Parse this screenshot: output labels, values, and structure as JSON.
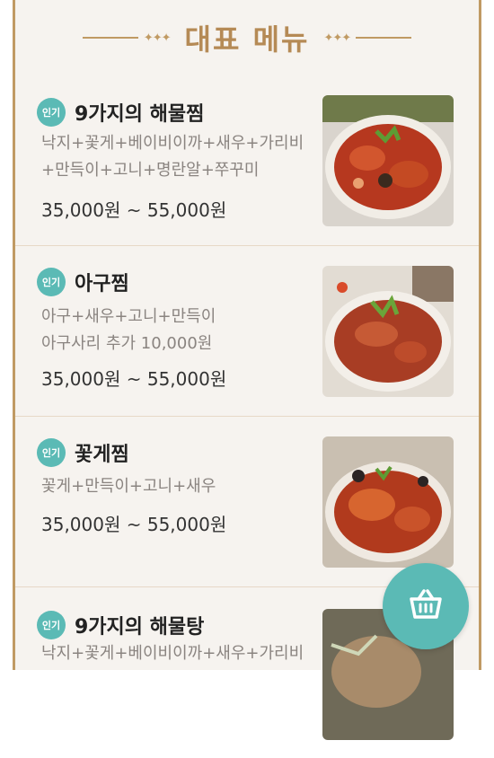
{
  "header": {
    "title": "대표 메뉴",
    "deco_left": "✦✦✦",
    "deco_right": "✦✦✦"
  },
  "menu": [
    {
      "badge": "인기",
      "name": "9가지의 해물찜",
      "desc_lines": [
        "낙지+꽃게+베이비이까+새우+가리비",
        "+만득이+고니+명란알+쭈꾸미"
      ],
      "price": "35,000원 ~ 55,000원"
    },
    {
      "badge": "인기",
      "name": "아구찜",
      "desc_lines": [
        "아구+새우+고니+만득이",
        "아구사리 추가 10,000원"
      ],
      "price": "35,000원 ~ 55,000원"
    },
    {
      "badge": "인기",
      "name": "꽃게찜",
      "desc_lines": [
        "꽃게+만득이+고니+새우"
      ],
      "price": "35,000원 ~ 55,000원"
    },
    {
      "badge": "인기",
      "name": "9가지의 해물탕",
      "desc_lines": [
        "낙지+꽃게+베이비이까+새우+가리비"
      ],
      "price": ""
    }
  ],
  "cart": {
    "icon": "shopping-basket-icon"
  }
}
